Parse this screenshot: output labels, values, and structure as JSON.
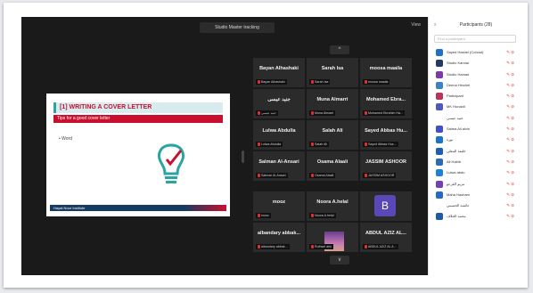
{
  "meeting": {
    "title": "Studio Master tracking",
    "view_label": "View",
    "nav_up": "^",
    "nav_down": "v"
  },
  "shared_slide": {
    "heading": "[1] WRITING A COVER LETTER",
    "subheading": "Tips for a good cover letter",
    "bullet": "• Word",
    "footer": "Hayat Noor Institute"
  },
  "tiles": [
    {
      "name": "Bayan Alhashaki",
      "label": "Bayan Alhashaki"
    },
    {
      "name": "Sarah Isa",
      "label": "Sarah Isa"
    },
    {
      "name": "moosa maaila",
      "label": "moosa maaila"
    },
    {
      "name": "جنيد عيسى",
      "label": "جنيد عيسى"
    },
    {
      "name": "Muna Almarri",
      "label": "Muna Almarri"
    },
    {
      "name": "Mohamed Ebra...",
      "label": "Mohamed Ebrahim Ha..."
    },
    {
      "name": "Lulwa Abdulla",
      "label": "Lulwa Abdulla"
    },
    {
      "name": "Salah Ali",
      "label": "Salah Ali"
    },
    {
      "name": "Sayed Abbas Hu...",
      "label": "Sayed Abbas Hus..."
    },
    {
      "name": "Salman Al-Ansari",
      "label": "Salman Al-Ansari"
    },
    {
      "name": "Osama Alaali",
      "label": "Osama Alaali"
    },
    {
      "name": "JASSIM ASHOOR",
      "label": "JASSIM ASHOOR"
    },
    {
      "name": "mooz",
      "label": "mooz"
    },
    {
      "name": "Noora A.helal",
      "label": "Noora A.helal"
    },
    {
      "name": "",
      "label": "",
      "avatar_letter": "B"
    },
    {
      "name": "albandary abbak...",
      "label": "albandary abbak..."
    },
    {
      "name": "",
      "label": "Ruthsel aris"
    },
    {
      "name": "ABDUL AZIZ AL...",
      "label": "ABDUL AZIZ AL A..."
    }
  ],
  "panel": {
    "title": "Participants (28)",
    "close": "x",
    "search_placeholder": "Find a participant",
    "participants": [
      {
        "name": "Sayed Hashel (Cohost)",
        "color": "#1f6fd1"
      },
      {
        "name": "Studio Kannar",
        "color": "#1f3b66"
      },
      {
        "name": "Studio Hamad",
        "color": "#7b3aa8"
      },
      {
        "name": "Deena Hinchel",
        "color": "#3a82c4"
      },
      {
        "name": "Participant",
        "color": "#b6355c"
      },
      {
        "name": "MK Hunaidi",
        "color": "#4d5ac0"
      },
      {
        "name": "جنيد عيسى",
        "color": "#ffffff"
      },
      {
        "name": "Salma Ali alvin",
        "color": "#3f4fd0"
      },
      {
        "name": "نورة",
        "color": "#1d73c9"
      },
      {
        "name": "خليفة البنعلي",
        "color": "#1c5fb5"
      },
      {
        "name": "Ali Habib",
        "color": "#2e6ab8"
      },
      {
        "name": "Lulwa abdu",
        "color": "#1e80d6"
      },
      {
        "name": "مريم القرعو",
        "color": "#7441b3"
      },
      {
        "name": "Maha Hasham",
        "color": "#2668c7"
      },
      {
        "name": "عائشة الحسيني",
        "color": "#ffffff"
      },
      {
        "name": "محمد الجلاف",
        "color": "#1d5aa8"
      }
    ]
  }
}
